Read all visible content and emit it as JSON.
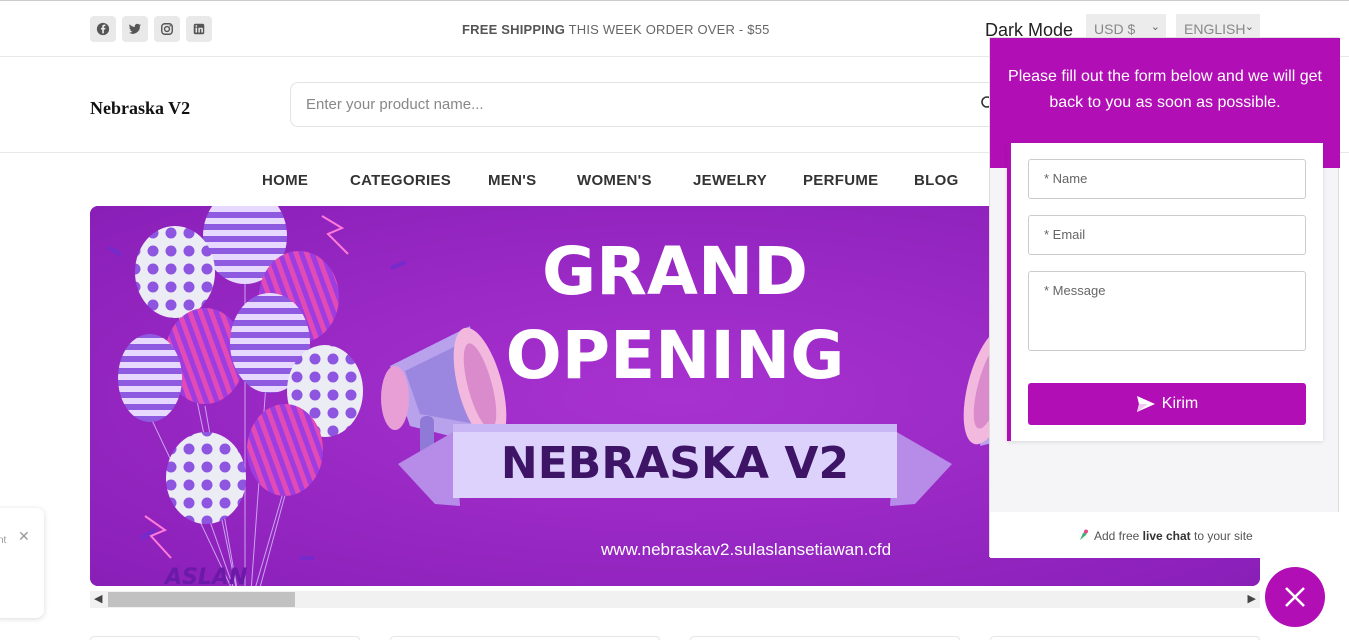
{
  "topbar": {
    "social": [
      "facebook-icon",
      "twitter-icon",
      "instagram-icon",
      "linkedin-icon"
    ],
    "shipping_bold": "FREE SHIPPING",
    "shipping_rest": " THIS WEEK ORDER OVER - $55",
    "dark_mode": "Dark Mode",
    "currency": "USD $",
    "language": "ENGLISH"
  },
  "header": {
    "logo": "Nebraska V2",
    "search_placeholder": "Enter your product name..."
  },
  "nav": {
    "items": [
      "HOME",
      "CATEGORIES",
      "MEN'S",
      "WOMEN'S",
      "JEWELRY",
      "PERFUME",
      "BLOG"
    ]
  },
  "banner": {
    "line1": "GRAND",
    "line2": "OPENING",
    "ribbon": "NEBRASKA V2",
    "url": "www.nebraskav2.sulaslansetiawan.cfd",
    "watermark": "ASLAN"
  },
  "widget": {
    "intro": "Please fill out the form below and we will get back to you as soon as possible.",
    "name_placeholder": "* Name",
    "email_placeholder": "* Email",
    "message_placeholder": "* Message",
    "send_label": "Kirim",
    "powered_pre": "Add free ",
    "powered_bold": "live chat",
    "powered_post": " to your site"
  },
  "popup_left": {
    "text": "nt"
  },
  "colors": {
    "accent": "#b10fb5",
    "banner_bg": "#9a27c2",
    "ribbon_text": "#3d1466"
  }
}
